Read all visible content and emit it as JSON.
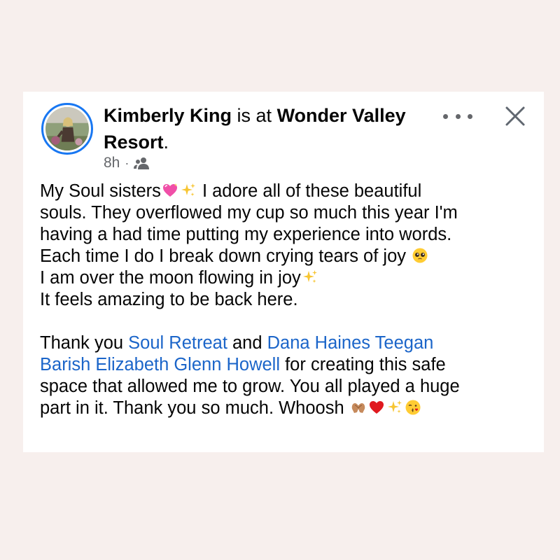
{
  "post": {
    "author": "Kimberly King",
    "connector": " is at ",
    "location": "Wonder Valley",
    "location_line2": "Resort",
    "period": ".",
    "time": "8h",
    "separator": "·",
    "audience_icon": "friends-icon",
    "more_icon": "more-options-icon",
    "close_icon": "close-icon"
  },
  "content": {
    "line1_a": "My Soul sisters",
    "line1_b": " I adore all of these beautiful",
    "line2": "souls. They overflowed my cup so much this year I'm",
    "line3": "having a had time putting my experience into words.",
    "line4": "Each time I do I break down crying tears of joy ",
    "line5": "I am over the moon flowing in joy",
    "line6": "It feels amazing to be back here.",
    "para2_a": "Thank you ",
    "link1": "Soul Retreat",
    "para2_b": " and ",
    "link2": "Dana Haines Teegan",
    "link3": "Barish Elizabeth Glenn Howell",
    "para2_c": " for creating this safe",
    "para2_d": "space that allowed me to grow. You all played a huge",
    "para2_e": "part in it. Thank you so much. Whoosh "
  },
  "emojis": [
    "sparkling-heart-emoji",
    "sparkles-emoji",
    "pleading-face-emoji",
    "sparkles-emoji",
    "heart-hands-emoji",
    "red-heart-emoji",
    "sparkles-emoji",
    "face-blowing-kiss-emoji"
  ],
  "colors": {
    "link": "#1b65c9",
    "accent_ring": "#1877f2",
    "meta": "#65676b",
    "background": "#f7efed"
  }
}
